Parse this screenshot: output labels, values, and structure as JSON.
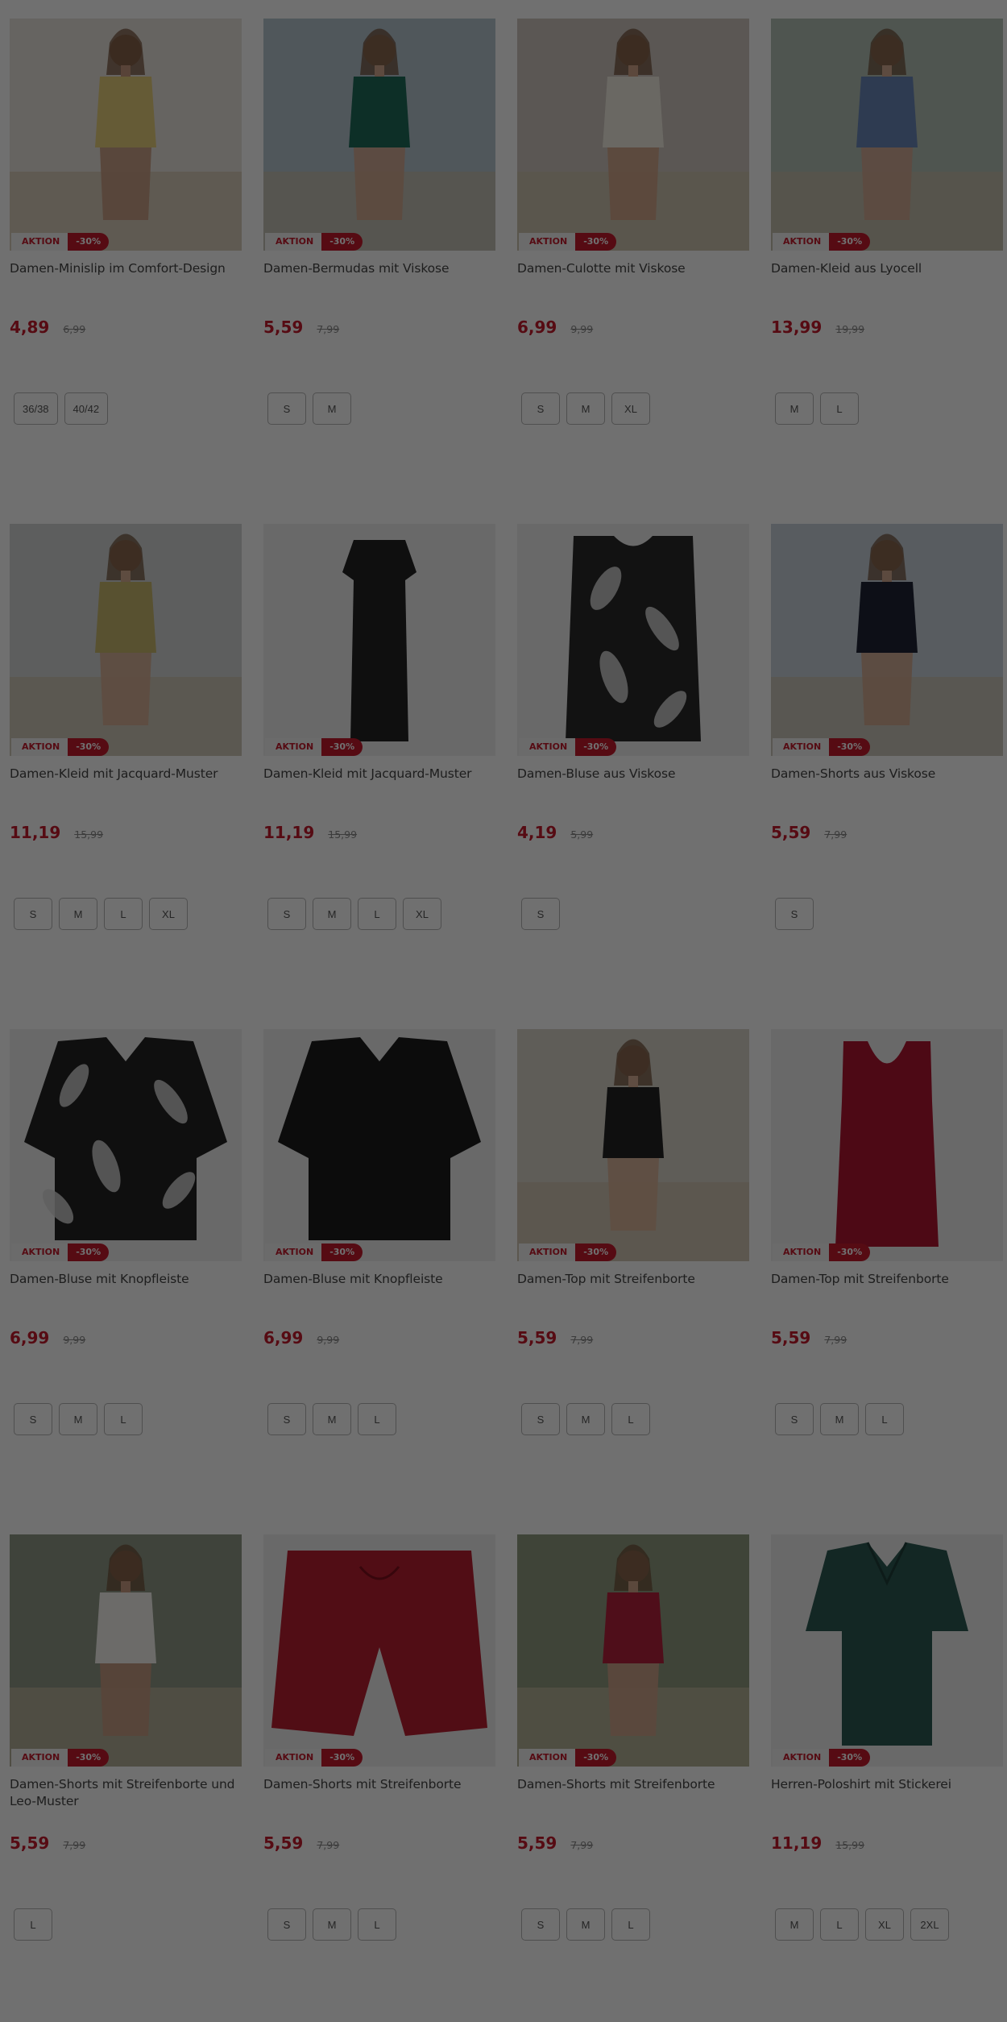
{
  "products": [
    {
      "title": "Damen-Minislip im Comfort-Design",
      "price": "4,89",
      "old_price": "6,99",
      "badge": "AKTION",
      "discount": "-30%",
      "sizes": [
        "36/38",
        "40/42"
      ],
      "image": "bikini-beach-photo",
      "colors": {
        "bg": "#e9e4dd",
        "main": "#e7cf7c",
        "skin": "#c89a80"
      }
    },
    {
      "title": "Damen-Bermudas mit Viskose",
      "price": "5,59",
      "old_price": "7,99",
      "badge": "AKTION",
      "discount": "-30%",
      "sizes": [
        "S",
        "M"
      ],
      "image": "model-tree-sea-photo",
      "colors": {
        "bg": "#b7c6d0",
        "main": "#1f6b5a",
        "skin": "#d4a98f"
      }
    },
    {
      "title": "Damen-Culotte mit Viskose",
      "price": "6,99",
      "old_price": "9,99",
      "badge": "AKTION",
      "discount": "-30%",
      "sizes": [
        "S",
        "M",
        "XL"
      ],
      "image": "model-beach-path-photo",
      "colors": {
        "bg": "#cfc7bf",
        "main": "#f1ece1",
        "skin": "#d1a488"
      }
    },
    {
      "title": "Damen-Kleid aus Lyocell",
      "price": "13,99",
      "old_price": "19,99",
      "badge": "AKTION",
      "discount": "-30%",
      "sizes": [
        "M",
        "L"
      ],
      "image": "model-blue-dress-photo",
      "colors": {
        "bg": "#b5c1b6",
        "main": "#6a86b8",
        "skin": "#d4aa92"
      }
    },
    {
      "title": "Damen-Kleid mit Jacquard-Muster",
      "price": "11,19",
      "old_price": "15,99",
      "badge": "AKTION",
      "discount": "-30%",
      "sizes": [
        "S",
        "M",
        "L",
        "XL"
      ],
      "image": "model-olive-dress-photo",
      "colors": {
        "bg": "#d3d7d5",
        "main": "#c9b86e",
        "skin": "#d6ad92"
      }
    },
    {
      "title": "Damen-Kleid mit Jacquard-Muster",
      "price": "11,19",
      "old_price": "15,99",
      "badge": "AKTION",
      "discount": "-30%",
      "sizes": [
        "S",
        "M",
        "L",
        "XL"
      ],
      "image": "black-dress-product",
      "colors": {
        "bg": "#efefef",
        "main": "#222222",
        "skin": "#efefef"
      }
    },
    {
      "title": "Damen-Bluse aus Viskose",
      "price": "4,19",
      "old_price": "5,99",
      "badge": "AKTION",
      "discount": "-30%",
      "sizes": [
        "S"
      ],
      "image": "leaf-print-top-product",
      "colors": {
        "bg": "#efefef",
        "main": "#2a2a2a",
        "skin": "#efefef"
      }
    },
    {
      "title": "Damen-Shorts aus Viskose",
      "price": "5,59",
      "old_price": "7,99",
      "badge": "AKTION",
      "discount": "-30%",
      "sizes": [
        "S"
      ],
      "image": "model-rock-shore-photo",
      "colors": {
        "bg": "#c9d2da",
        "main": "#1e2436",
        "skin": "#d2a88f"
      }
    },
    {
      "title": "Damen-Bluse mit Knopfleiste",
      "price": "6,99",
      "old_price": "9,99",
      "badge": "AKTION",
      "discount": "-30%",
      "sizes": [
        "S",
        "M",
        "L"
      ],
      "image": "leaf-print-blouse-product",
      "colors": {
        "bg": "#efefef",
        "main": "#232323",
        "skin": "#efefef"
      }
    },
    {
      "title": "Damen-Bluse mit Knopfleiste",
      "price": "6,99",
      "old_price": "9,99",
      "badge": "AKTION",
      "discount": "-30%",
      "sizes": [
        "S",
        "M",
        "L"
      ],
      "image": "black-blouse-product",
      "colors": {
        "bg": "#efefef",
        "main": "#1c1c1c",
        "skin": "#efefef"
      }
    },
    {
      "title": "Damen-Top mit Streifenborte",
      "price": "5,59",
      "old_price": "7,99",
      "badge": "AKTION",
      "discount": "-30%",
      "sizes": [
        "S",
        "M",
        "L"
      ],
      "image": "model-black-top-photo",
      "colors": {
        "bg": "#d8d3c9",
        "main": "#222222",
        "skin": "#d9b096"
      }
    },
    {
      "title": "Damen-Top mit Streifenborte",
      "price": "5,59",
      "old_price": "7,99",
      "badge": "AKTION",
      "discount": "-30%",
      "sizes": [
        "S",
        "M",
        "L"
      ],
      "image": "red-tank-top-product",
      "colors": {
        "bg": "#efefef",
        "main": "#b01530",
        "skin": "#efefef"
      }
    },
    {
      "title": "Damen-Shorts mit Streifenborte und Leo-Muster",
      "price": "5,59",
      "old_price": "7,99",
      "badge": "AKTION",
      "discount": "-30%",
      "sizes": [
        "L"
      ],
      "image": "model-white-tee-photo",
      "colors": {
        "bg": "#8f9a86",
        "main": "#f5f3ef",
        "skin": "#c99b82"
      }
    },
    {
      "title": "Damen-Shorts mit Streifenborte",
      "price": "5,59",
      "old_price": "7,99",
      "badge": "AKTION",
      "discount": "-30%",
      "sizes": [
        "S",
        "M",
        "L"
      ],
      "image": "red-shorts-product",
      "colors": {
        "bg": "#efefef",
        "main": "#b81f30",
        "skin": "#efefef"
      }
    },
    {
      "title": "Damen-Shorts mit Streifenborte",
      "price": "5,59",
      "old_price": "7,99",
      "badge": "AKTION",
      "discount": "-30%",
      "sizes": [
        "S",
        "M",
        "L"
      ],
      "image": "model-red-tee-photo",
      "colors": {
        "bg": "#8f9b80",
        "main": "#b3213c",
        "skin": "#d0a48a"
      }
    },
    {
      "title": "Herren-Poloshirt mit Stickerei",
      "price": "11,19",
      "old_price": "15,99",
      "badge": "AKTION",
      "discount": "-30%",
      "sizes": [
        "M",
        "L",
        "XL",
        "2XL"
      ],
      "image": "green-polo-product",
      "colors": {
        "bg": "#efefef",
        "main": "#2c5a52",
        "skin": "#efefef"
      }
    }
  ]
}
